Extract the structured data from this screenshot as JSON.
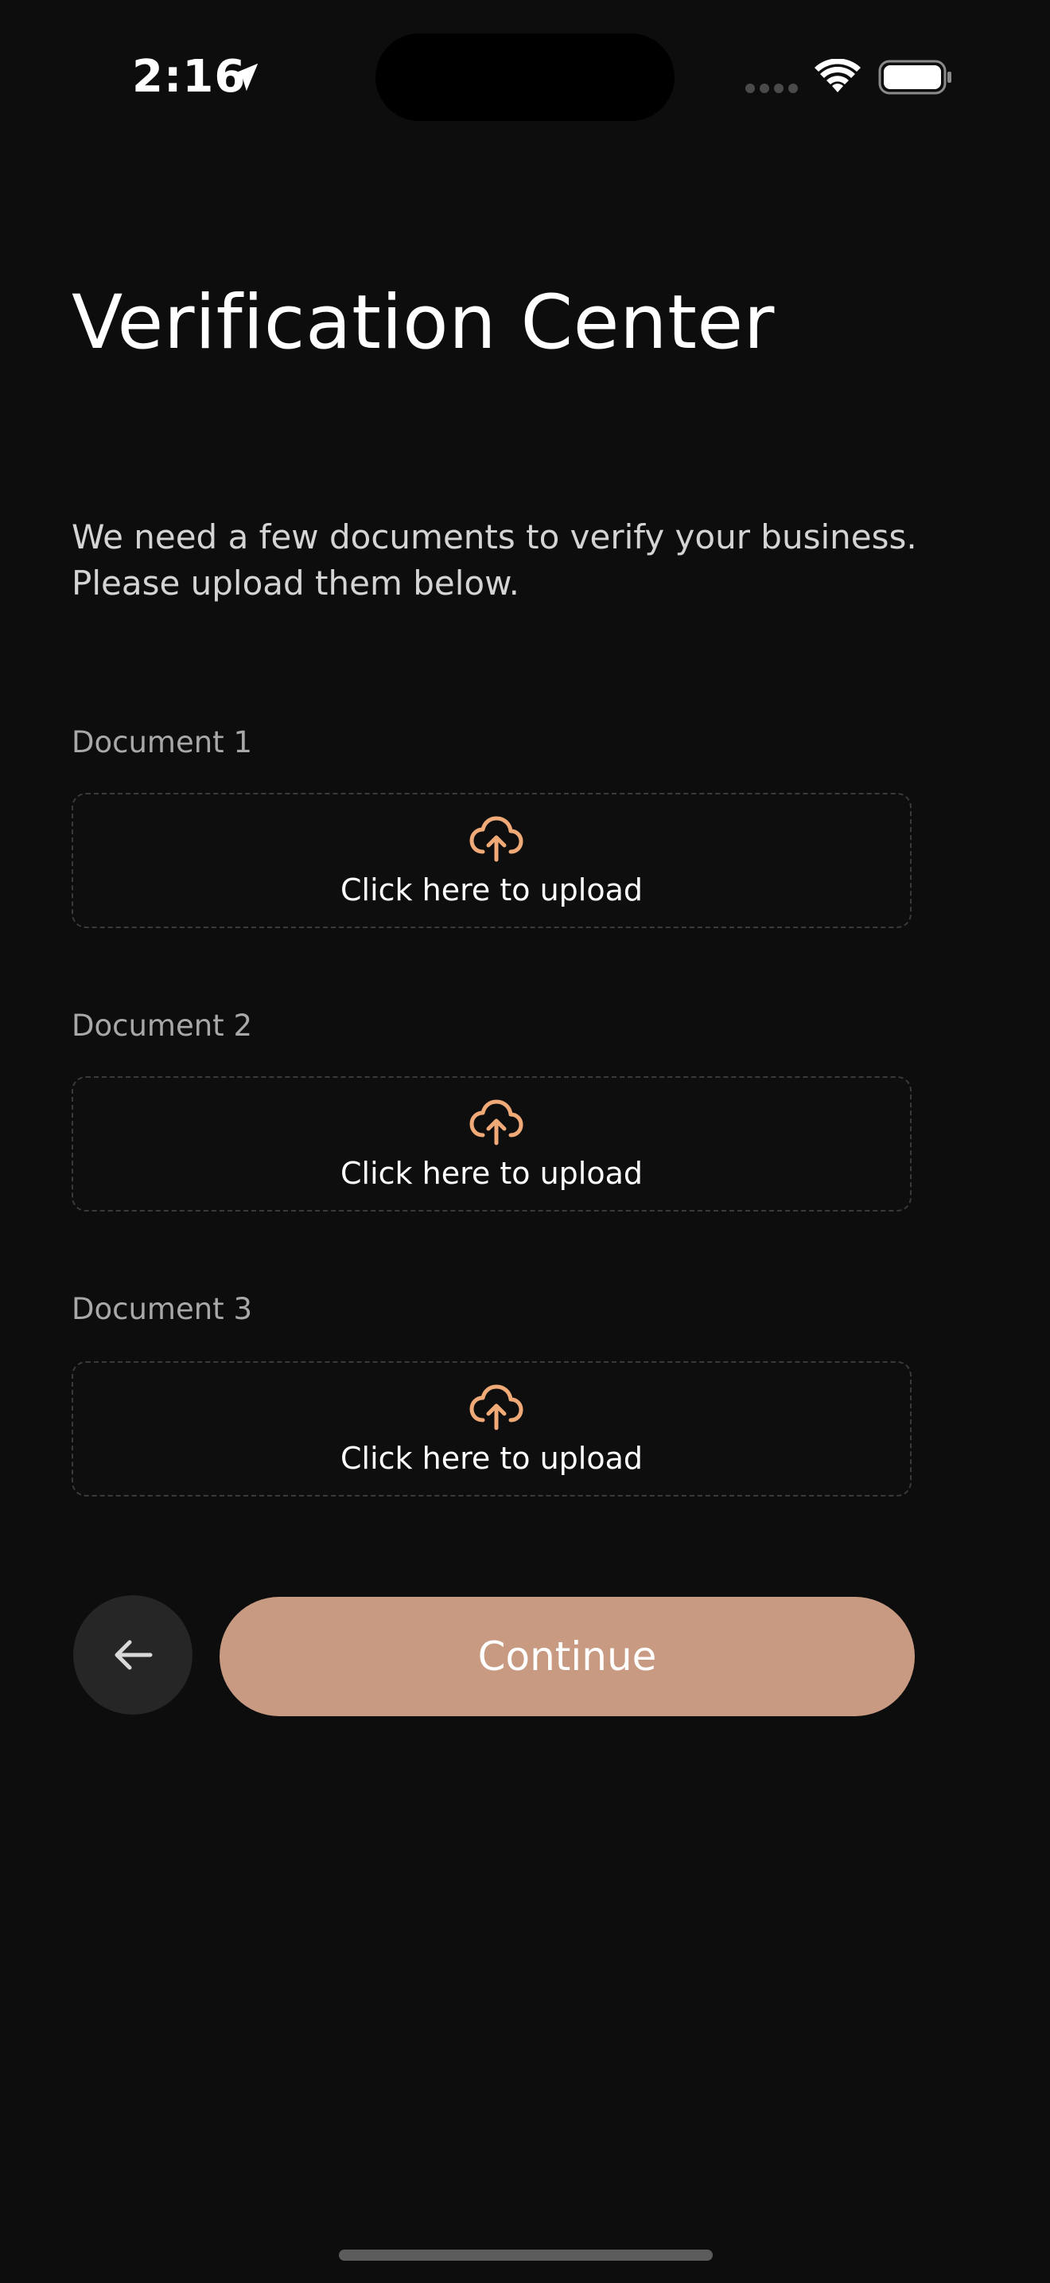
{
  "status_bar": {
    "time": "2:16",
    "icons": [
      "location-arrow-icon",
      "signal-icon",
      "wifi-icon",
      "battery-icon"
    ]
  },
  "page": {
    "title": "Verification Center",
    "description": "We need a few documents to verify your business. Please upload them below."
  },
  "documents": [
    {
      "label": "Document 1",
      "upload_text": "Click here to upload",
      "icon": "cloud-upload-icon"
    },
    {
      "label": "Document 2",
      "upload_text": "Click here to upload",
      "icon": "cloud-upload-icon"
    },
    {
      "label": "Document 3",
      "upload_text": "Click here to upload",
      "icon": "cloud-upload-icon"
    }
  ],
  "actions": {
    "back_icon": "arrow-left-icon",
    "continue_label": "Continue"
  },
  "colors": {
    "background": "#0d0d0d",
    "accent": "#c99a82",
    "upload_icon": "#f0aa78",
    "back_button": "#262626"
  }
}
